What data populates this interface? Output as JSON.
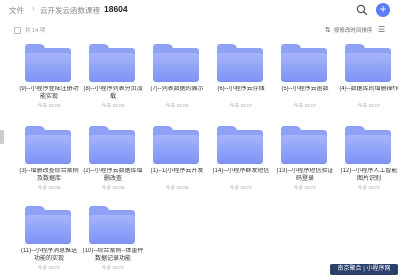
{
  "breadcrumb": {
    "root": "文件",
    "parent": "云开发云函数课程",
    "current": "18604"
  },
  "toolbar": {
    "count": "共 14 项",
    "sort_label": "按修改时间排序"
  },
  "colors": {
    "accent": "#5b7cf7",
    "folder": "#8ea1f4"
  },
  "icons": {
    "search": "search-icon",
    "add": "plus-icon",
    "sort": "sort-icon",
    "view": "list-view-icon"
  },
  "folders": [
    {
      "name": "(9)--小程序登陆注册功能实现",
      "date": "今天 18:08"
    },
    {
      "name": "(8)--小程序列表分页加载",
      "date": "今天 18:08"
    },
    {
      "name": "(7)--列表数据的展示",
      "date": "今天 18:08"
    },
    {
      "name": "(6)--小程序云存储",
      "date": "今天 18:07"
    },
    {
      "name": "(5)--小程序云函数",
      "date": "今天 18:07"
    },
    {
      "name": "(4)--数据库的增删操作",
      "date": "今天 18:07"
    },
    {
      "name": "(3)--增删改查综合案例及数据库",
      "date": "今天 18:06"
    },
    {
      "name": "(2)--小程序云数据库增删改查",
      "date": "今天 18:06"
    },
    {
      "name": "(1)--1(小程序云开发",
      "date": "今天 18:06"
    },
    {
      "name": "(14)--小程序群发短信",
      "date": "今天 18:07"
    },
    {
      "name": "(13)--小程序短信验证码登录",
      "date": "今天 18:07"
    },
    {
      "name": "(12)--小程序人工智能图片识别",
      "date": "今天 18:07"
    },
    {
      "name": "(11)--小程序消息推送功能的实现",
      "date": "今天 18:07"
    },
    {
      "name": "(10)--综合案例--体重秤数据记录功能",
      "date": "今天 18:07"
    }
  ],
  "watermark": "南京聚合 | 小程序网"
}
